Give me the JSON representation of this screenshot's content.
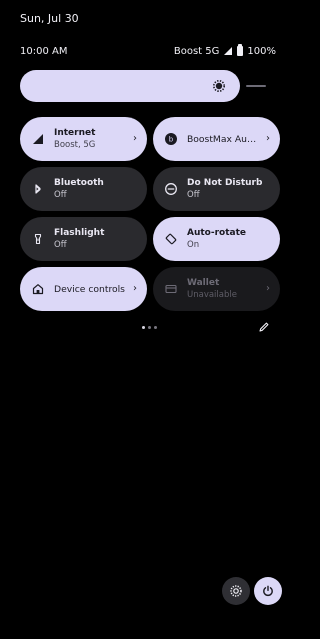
{
  "status": {
    "date": "Sun, Jul 30",
    "time": "10:00 AM",
    "carrier": "Boost 5G",
    "battery": "100%"
  },
  "brightness": {
    "level": 0.83,
    "icon": "brightness-icon"
  },
  "tiles": [
    {
      "title": "Internet",
      "subtitle": "Boost, 5G",
      "icon": "signal-icon",
      "has_chevron": true,
      "state": "active"
    },
    {
      "title": "BoostMax Audio",
      "subtitle": "",
      "icon": "boost-icon",
      "has_chevron": true,
      "state": "active"
    },
    {
      "title": "Bluetooth",
      "subtitle": "Off",
      "icon": "bluetooth-icon",
      "has_chevron": false,
      "state": "inactive"
    },
    {
      "title": "Do Not Disturb",
      "subtitle": "Off",
      "icon": "do-not-disturb-icon",
      "has_chevron": false,
      "state": "inactive"
    },
    {
      "title": "Flashlight",
      "subtitle": "Off",
      "icon": "flashlight-icon",
      "has_chevron": false,
      "state": "inactive"
    },
    {
      "title": "Auto-rotate",
      "subtitle": "On",
      "icon": "rotate-icon",
      "has_chevron": false,
      "state": "active"
    },
    {
      "title": "Device controls",
      "subtitle": "",
      "icon": "home-icon",
      "has_chevron": true,
      "state": "active"
    },
    {
      "title": "Wallet",
      "subtitle": "Unavailable",
      "icon": "wallet-icon",
      "has_chevron": true,
      "state": "disabled"
    }
  ],
  "pager": {
    "pages": 3,
    "active": 1
  },
  "footer": {
    "settings_icon": "settings-icon",
    "power_icon": "power-icon"
  },
  "colors": {
    "accent": "#dcd8f7",
    "background": "#000000",
    "tile_dark": "#2a2a2e"
  }
}
